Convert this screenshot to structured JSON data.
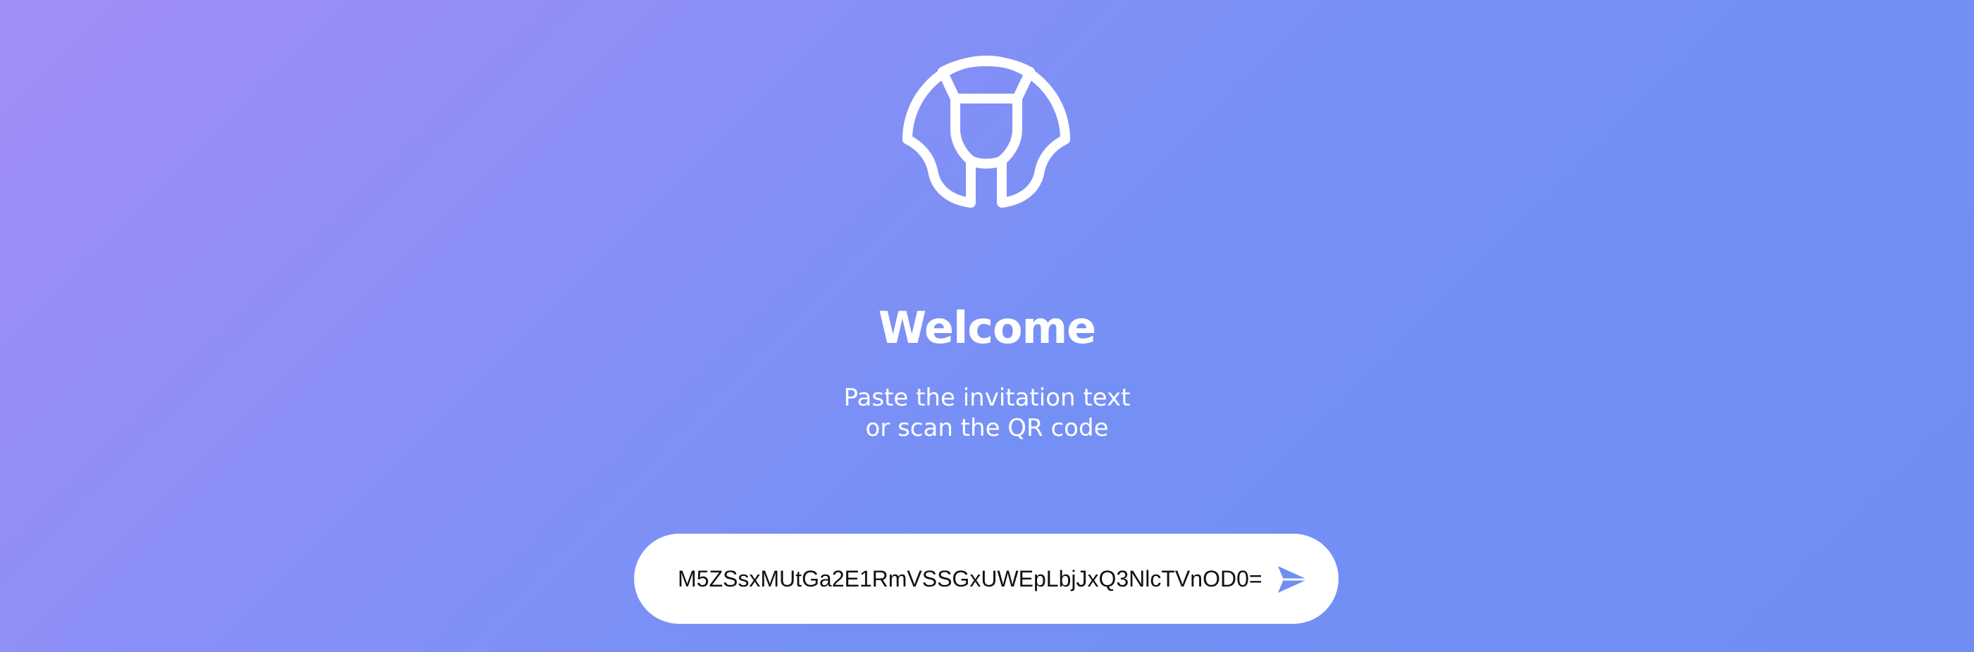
{
  "welcome": {
    "title": "Welcome",
    "subtitle_line1": "Paste the invitation text",
    "subtitle_line2": "or scan the QR code"
  },
  "invite": {
    "value": "M5ZSsxMUtGa2E1RmVSSGxUWEpLbjJxQ3NlcTVnOD0=",
    "send_icon": "send-icon"
  },
  "logo": {
    "icon": "app-logo-icon"
  },
  "colors": {
    "background_start": "#a18ef6",
    "background_end": "#6e8ef4",
    "accent": "#6f8ff2",
    "text": "#ffffff"
  }
}
